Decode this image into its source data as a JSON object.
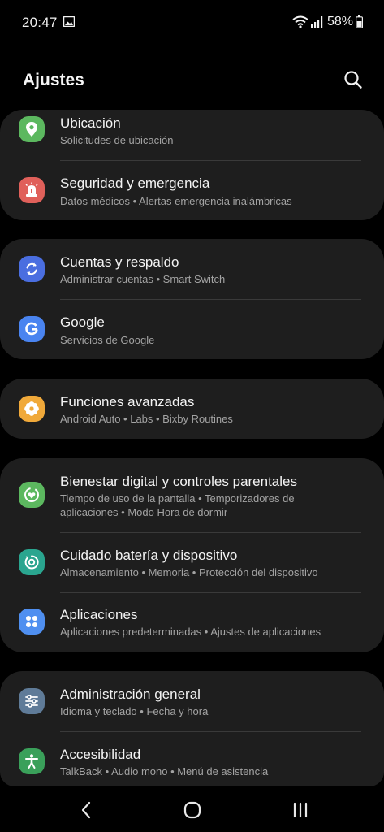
{
  "status_bar": {
    "time": "20:47",
    "battery_percent": "58%",
    "icons": [
      "gallery-icon",
      "wifi-icon",
      "signal-icon",
      "battery-icon"
    ]
  },
  "header": {
    "title": "Ajustes",
    "search_icon": "search-icon"
  },
  "sections": [
    {
      "items": [
        {
          "title": "Ubicación",
          "subtitle": "Solicitudes de ubicación",
          "icon": "location-pin-icon",
          "icon_color": "#5cb85f"
        },
        {
          "title": "Seguridad y emergencia",
          "subtitle": "Datos médicos • Alertas emergencia inalámbricas",
          "icon": "emergency-icon",
          "icon_color": "#e0605a"
        }
      ]
    },
    {
      "items": [
        {
          "title": "Cuentas y respaldo",
          "subtitle": "Administrar cuentas • Smart Switch",
          "icon": "sync-icon",
          "icon_color": "#4a6ee0"
        },
        {
          "title": "Google",
          "subtitle": "Servicios de Google",
          "icon": "google-icon",
          "icon_color": "#4a84f0"
        }
      ]
    },
    {
      "items": [
        {
          "title": "Funciones avanzadas",
          "subtitle": "Android Auto • Labs • Bixby Routines",
          "icon": "advanced-features-icon",
          "icon_color": "#f0a93a"
        }
      ]
    },
    {
      "items": [
        {
          "title": "Bienestar digital y controles parentales",
          "subtitle": "Tiempo de uso de la pantalla • Temporizadores de aplicaciones • Modo Hora de dormir",
          "icon": "wellbeing-icon",
          "icon_color": "#5cb85f"
        },
        {
          "title": "Cuidado batería y dispositivo",
          "subtitle": "Almacenamiento • Memoria • Protección del dispositivo",
          "icon": "device-care-icon",
          "icon_color": "#2aa58f"
        },
        {
          "title": "Aplicaciones",
          "subtitle": "Aplicaciones predeterminadas • Ajustes de aplicaciones",
          "icon": "apps-icon",
          "icon_color": "#4f8ff0"
        }
      ]
    },
    {
      "items": [
        {
          "title": "Administración general",
          "subtitle": "Idioma y teclado • Fecha y hora",
          "icon": "sliders-icon",
          "icon_color": "#5f7b98"
        },
        {
          "title": "Accesibilidad",
          "subtitle": "TalkBack • Audio mono • Menú de asistencia",
          "icon": "accessibility-icon",
          "icon_color": "#3aa05a"
        }
      ]
    }
  ],
  "nav_bar": {
    "back_icon": "back-icon",
    "home_icon": "home-icon",
    "recents_icon": "recents-icon"
  }
}
